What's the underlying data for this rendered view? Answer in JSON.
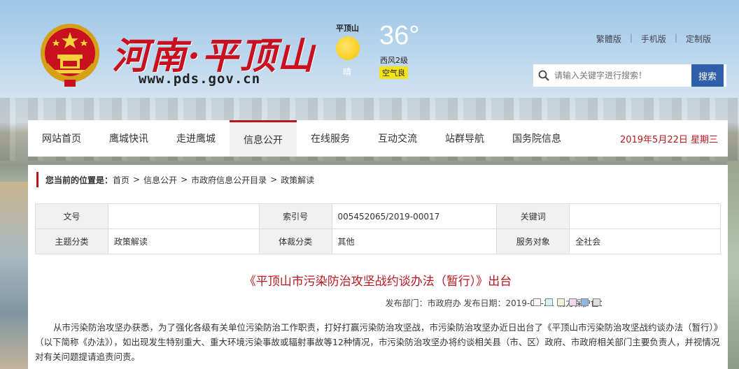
{
  "header": {
    "site_title": "河南·平顶山",
    "site_url": "www.pds.gov.cn",
    "weather": {
      "city": "平顶山",
      "temperature": "36°",
      "condition": "晴",
      "wind": "西风2级",
      "air_quality": "空气良"
    },
    "top_links": [
      "繁體版",
      "手机版",
      "定制版"
    ],
    "search": {
      "placeholder": "请输入关键字进行搜索！",
      "button": "搜索"
    }
  },
  "nav": {
    "items": [
      "网站首页",
      "鹰城快讯",
      "走进鹰城",
      "信息公开",
      "在线服务",
      "互动交流",
      "站群导航",
      "国务院信息"
    ],
    "active_index": 3,
    "date": "2019年5月22日 星期三"
  },
  "breadcrumb": {
    "lead": "您当前的位置是：",
    "items": [
      "首页",
      "信息公开",
      "市政府信息公开目录",
      "政策解读"
    ],
    "separator": ">"
  },
  "meta_table": {
    "rows": [
      [
        "文号",
        "",
        "索引号",
        "005452065/2019-00017",
        "关键词",
        ""
      ],
      [
        "主题分类",
        "政策解读",
        "体裁分类",
        "其他",
        "服务对象",
        "全社会"
      ]
    ]
  },
  "article": {
    "title": "《平顶山市污染防治攻坚战约谈办法（暂行）》出台",
    "meta_text": "发布部门：市政府办 发布日期：2019-05-21 视力保护色：",
    "protect_colors": [
      "#fafafa",
      "#d7f3f6",
      "#f3f6d7",
      "#f6d7f3",
      "#8fb8e8",
      "#dedede"
    ],
    "body": "从市污染防治攻坚办获悉，为了强化各级有关单位污染防治工作职责，打好打赢污染防治攻坚战，市污染防治攻坚办近日出台了《平顶山市污染防治攻坚战约谈办法（暂行）》（以下简称《办法》），如出现发生特别重大、重大环境污染事故或辐射事故等12种情况，市污染防治攻坚办将约谈相关县（市、区）政府、市政府相关部门主要负责人，并视情况对有关问题提请追责问责。"
  },
  "colors": {
    "accent": "#b8171d",
    "search_button": "#2f5fa8"
  }
}
